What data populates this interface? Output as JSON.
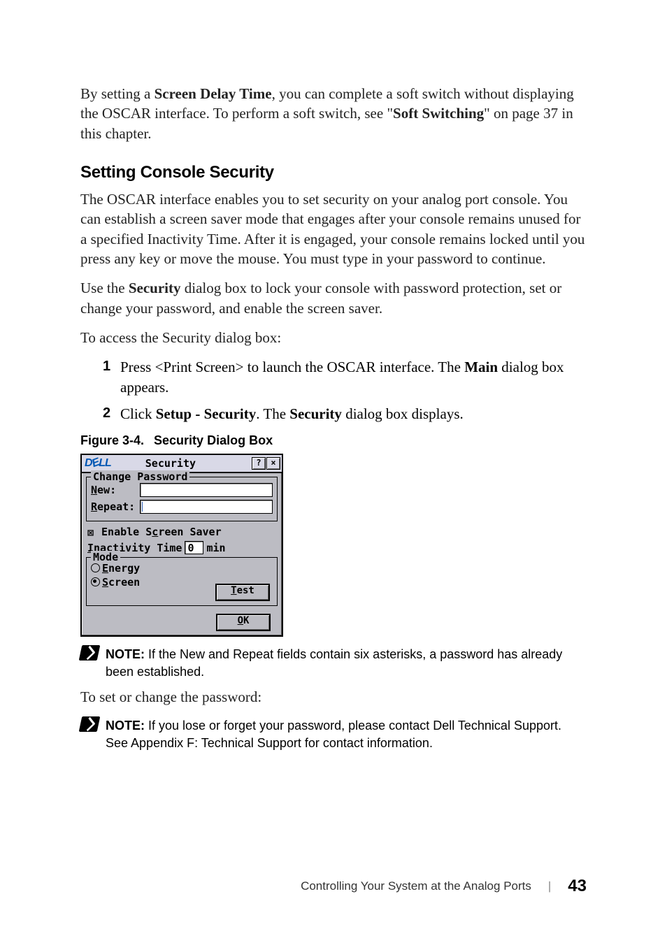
{
  "para1_a": "By setting a ",
  "para1_b": "Screen Delay Time",
  "para1_c": ", you can complete a soft switch without displaying the OSCAR interface. To perform a soft switch, see \"",
  "para1_d": "Soft Switching",
  "para1_e": "\" on page 37 in this chapter.",
  "heading": "Setting Console Security",
  "para2": "The OSCAR interface enables you to set security on your analog port console. You can establish a screen saver mode that engages after your console remains unused for a specified Inactivity Time. After it is engaged, your console remains locked until you press any key or move the mouse. You must type in your password to continue.",
  "para3_a": "Use the ",
  "para3_b": "Security",
  "para3_c": " dialog box to lock your console with password protection, set or change your password, and enable the screen saver.",
  "para4": "To access the Security dialog box:",
  "step1_num": "1",
  "step1_a": "Press <Print Screen> to launch the OSCAR interface. The ",
  "step1_b": "Main",
  "step1_c": " dialog box appears.",
  "step2_num": "2",
  "step2_a": "Click ",
  "step2_b": "Setup - Security",
  "step2_c": ". The ",
  "step2_d": "Security",
  "step2_e": " dialog box displays.",
  "figcap_a": "Figure 3-4.",
  "figcap_b": "Security Dialog Box",
  "dialog": {
    "logo": "D?LL",
    "title": "Security",
    "help": "?",
    "close": "×",
    "change_password_legend": "Change Password",
    "new_label_pre": "N",
    "new_label_post": "ew:",
    "repeat_label_pre": "R",
    "repeat_label_post": "epeat:",
    "enable_ss_box": "⊠",
    "enable_ss_a": "Enable S",
    "enable_ss_u": "c",
    "enable_ss_b": "reen Saver",
    "inact_pre": "I",
    "inact_post": "nactivity Time",
    "inact_val": "0",
    "inact_unit": "min",
    "mode_legend": "Mode",
    "energy_u": "E",
    "energy_post": "nergy",
    "screen_u": "S",
    "screen_post": "creen",
    "test_u": "T",
    "test_post": "est",
    "ok_u": "O",
    "ok_post": "K"
  },
  "note1_label": "NOTE:",
  "note1_text": " If the New and Repeat fields contain six asterisks, a password has already been established.",
  "para5": "To set or change the password:",
  "note2_label": "NOTE:",
  "note2_text": " If you lose or forget your password, please contact Dell Technical Support. See Appendix F: Technical Support for contact information.",
  "footer_text": "Controlling Your System at the Analog Ports",
  "footer_page": "43"
}
